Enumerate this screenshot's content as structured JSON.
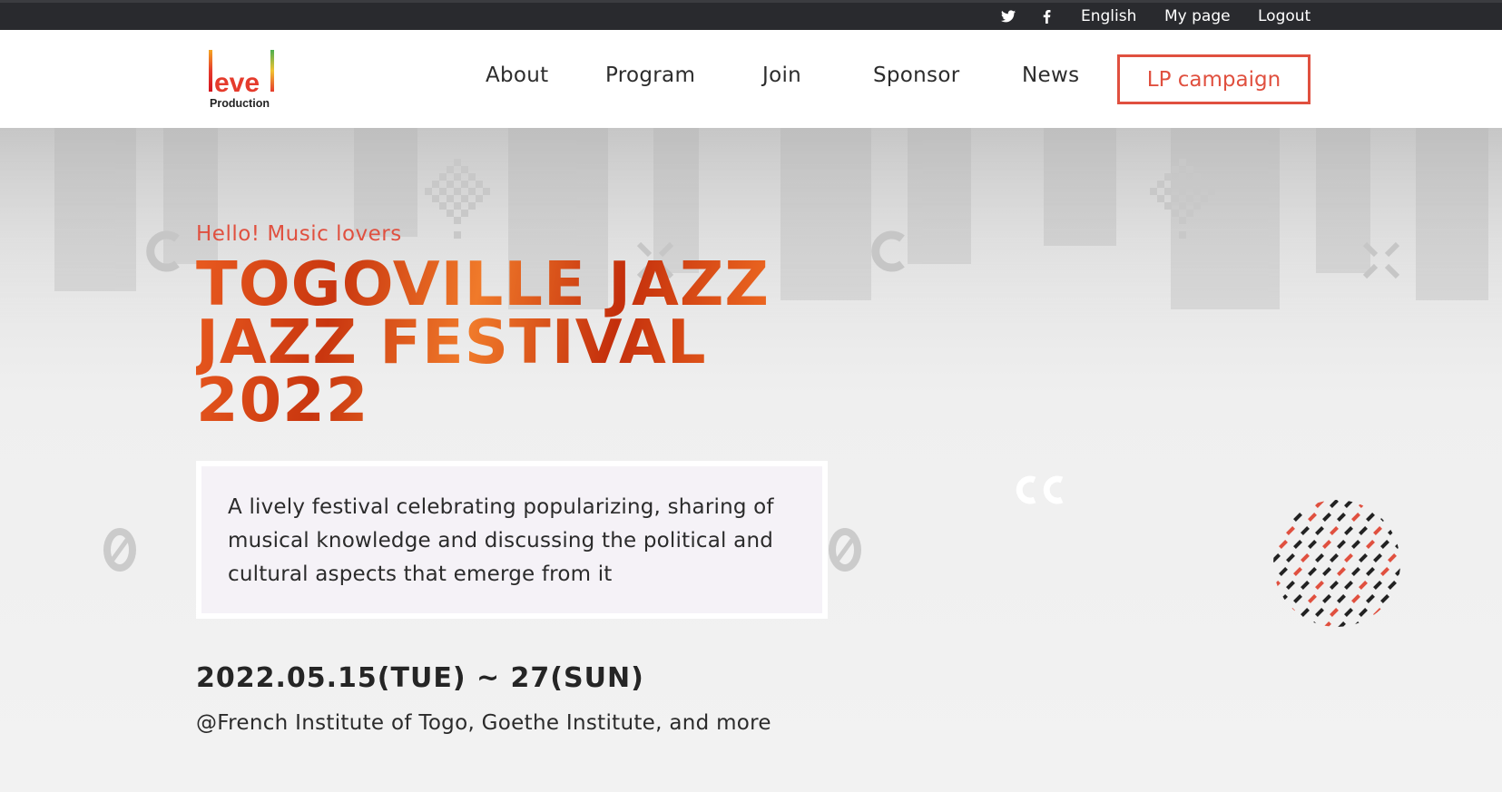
{
  "topbar": {
    "twitter_icon": "twitter-icon",
    "facebook_icon": "facebook-icon",
    "language": "English",
    "mypage": "My page",
    "logout": "Logout"
  },
  "header": {
    "logo": {
      "word": "level",
      "sub": "Production"
    },
    "nav": [
      "About",
      "Program",
      "Join",
      "Sponsor",
      "News"
    ],
    "cta": "LP campaign"
  },
  "hero": {
    "greeting": "Hello! Music lovers",
    "title_lines": [
      "TOGOVILLE JAZZ",
      "JAZZ FESTIVAL",
      "2022"
    ],
    "description": "A lively festival celebrating popularizing, sharing of musical knowledge and discussing the political and cultural aspects that emerge from it",
    "date": "2022.05.15(TUE) ~ 27(SUN)",
    "venue": "@French Institute of Togo, Goethe Institute, and more"
  },
  "colors": {
    "accent": "#e0503f",
    "topbar": "#292a2e",
    "title_orange": "#e85a1f"
  }
}
